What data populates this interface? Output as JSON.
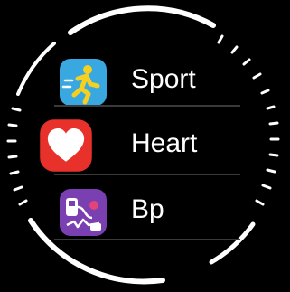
{
  "screen": {
    "background": "#000000",
    "bezel_color": "#ffffff"
  },
  "menu": {
    "items": [
      {
        "label": "Sport",
        "icon": "running-person-icon",
        "icon_color": "#3aa8e0",
        "accent_color": "#f5d020"
      },
      {
        "label": "Heart",
        "icon": "heart-icon",
        "icon_color": "#e8312a",
        "accent_color": "#ffffff"
      },
      {
        "label": "Bp",
        "icon": "blood-pressure-icon",
        "icon_color": "#7a3fb0",
        "accent_color": "#ffffff"
      }
    ]
  }
}
